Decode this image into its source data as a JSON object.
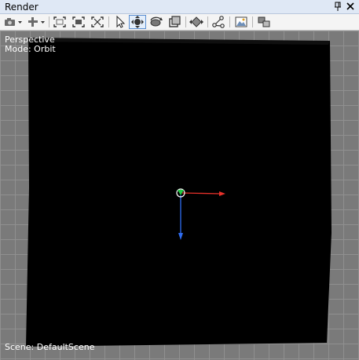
{
  "window": {
    "title": "Render",
    "pin_icon": "pin-icon",
    "close_icon": "close-icon"
  },
  "toolbar": {
    "buttons": [
      {
        "name": "camera-dropdown-button",
        "icon": "camera-icon"
      },
      {
        "name": "tool-dropdown-button",
        "icon": "wrench-icon"
      },
      {
        "name": "zoom-extents-button",
        "icon": "zoom-extents-icon"
      },
      {
        "name": "zoom-selected-button",
        "icon": "zoom-selected-icon"
      },
      {
        "name": "zoom-region-button",
        "icon": "zoom-region-icon"
      },
      {
        "name": "select-tool-button",
        "icon": "cursor-arrow-icon"
      },
      {
        "name": "move-tool-button",
        "icon": "move-icon",
        "active": true
      },
      {
        "name": "rotate-tool-button",
        "icon": "rotate-icon"
      },
      {
        "name": "scale-tool-button",
        "icon": "scale-icon"
      },
      {
        "name": "pan-tool-button",
        "icon": "pan-icon"
      },
      {
        "name": "connect-tool-button",
        "icon": "connect-icon"
      },
      {
        "name": "screenshot-button",
        "icon": "image-icon"
      },
      {
        "name": "layers-button",
        "icon": "layers-icon"
      }
    ]
  },
  "viewport": {
    "projection": "Perspective",
    "mode": "Mode: Orbit",
    "scene_label": "Scene: DefaultScene",
    "colors": {
      "background": "#000000",
      "grid": "#7a7a7a",
      "x_axis": "#e8312a",
      "y_axis": "#2f6cf0",
      "z_axis": "#22cc44"
    }
  }
}
